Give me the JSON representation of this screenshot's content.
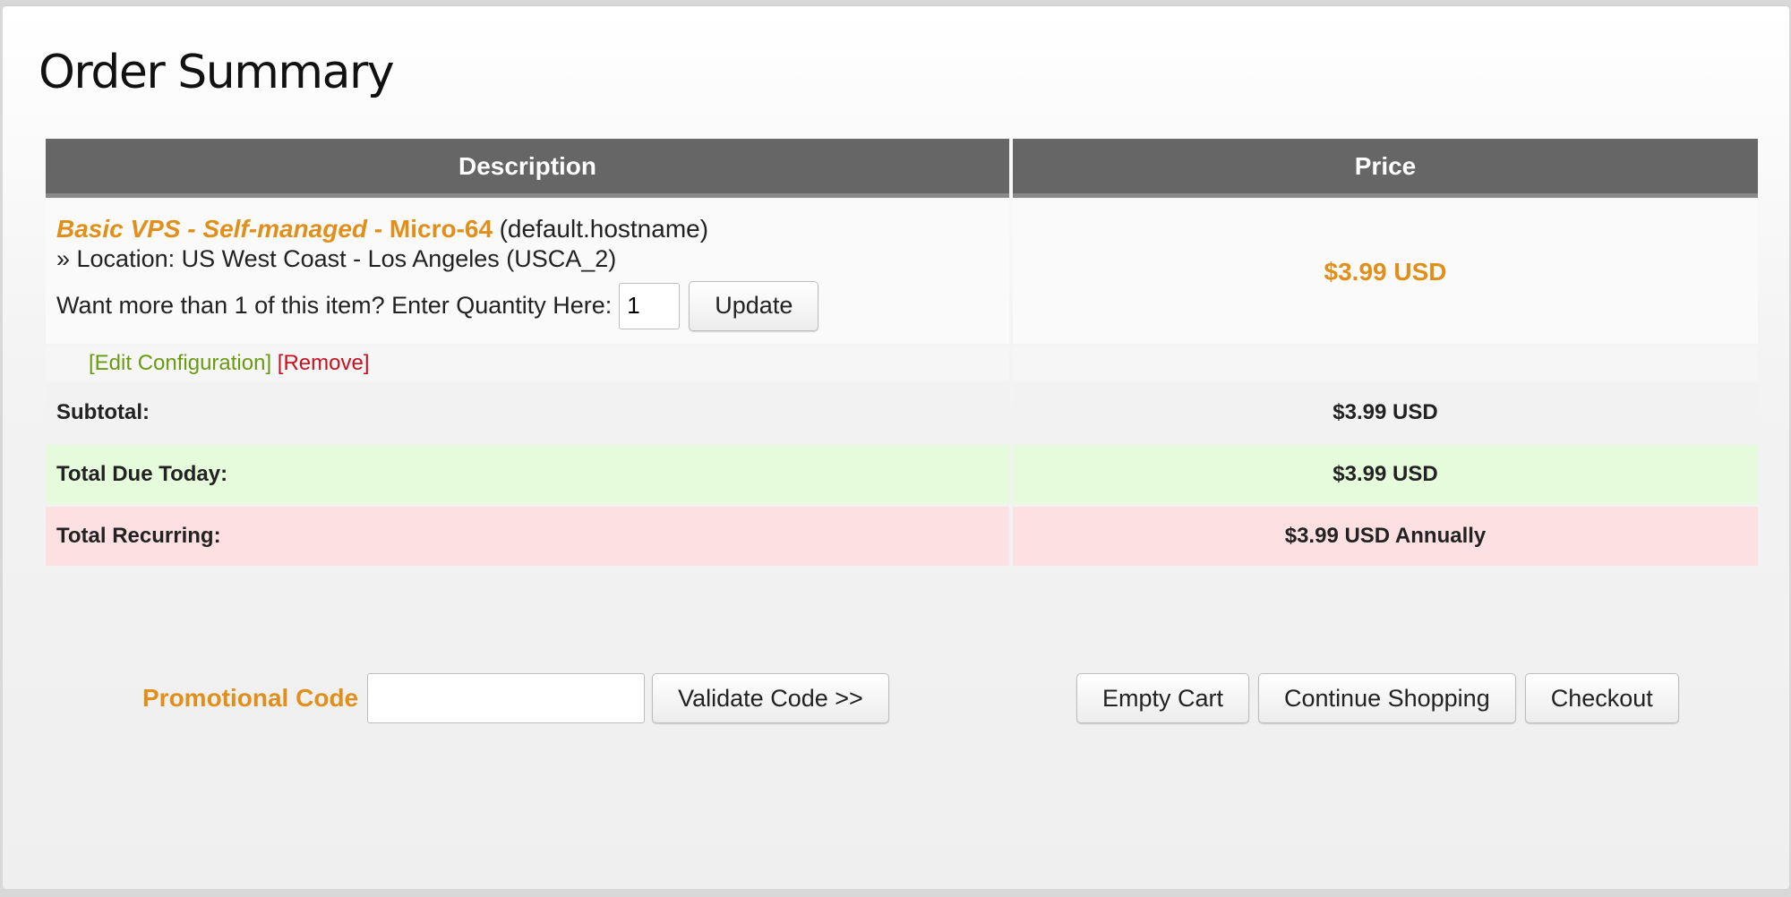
{
  "page": {
    "title": "Order Summary"
  },
  "table": {
    "headers": {
      "description": "Description",
      "price": "Price"
    },
    "item": {
      "name_part1": "Basic VPS - Self-managed",
      "name_sep": " - ",
      "name_part2": "Micro-64",
      "hostname": "(default.hostname)",
      "location": "» Location: US West Coast - Los Angeles (USCA_2)",
      "qty_prompt": "Want more than 1 of this item? Enter Quantity Here:",
      "qty_value": "1",
      "update_label": "Update",
      "price": "$3.99 USD",
      "edit_label": "[Edit Configuration]",
      "remove_label": "[Remove]"
    },
    "subtotal": {
      "label": "Subtotal:",
      "value": "$3.99 USD"
    },
    "total_due": {
      "label": "Total Due Today:",
      "value": "$3.99 USD"
    },
    "total_recurring": {
      "label": "Total Recurring:",
      "value": "$3.99 USD Annually"
    }
  },
  "promo": {
    "label": "Promotional Code",
    "input_value": "",
    "validate_label": "Validate Code >>"
  },
  "cart_actions": {
    "empty_label": "Empty Cart",
    "continue_label": "Continue Shopping",
    "checkout_label": "Checkout"
  },
  "colors": {
    "accent_orange": "#e0901a",
    "header_gray": "#666666",
    "due_green": "#e6fbdc",
    "recurring_pink": "#fde0e2",
    "edit_green": "#6a9a12",
    "remove_red": "#c8101e"
  }
}
